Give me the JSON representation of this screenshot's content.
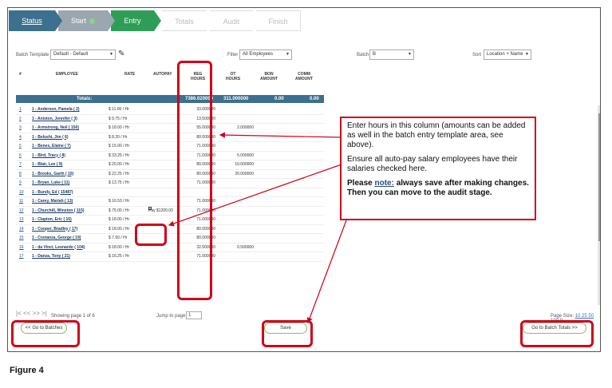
{
  "steps": [
    {
      "label": "Status"
    },
    {
      "label": "Start"
    },
    {
      "label": "Entry"
    },
    {
      "label": "Totals"
    },
    {
      "label": "Audit"
    },
    {
      "label": "Finish"
    }
  ],
  "filters": {
    "batch_template_label": "Batch Template",
    "batch_template_value": "Default - Default",
    "filter_label": "Filter",
    "filter_value": "All Employees",
    "batch_label": "Batch",
    "batch_value": "B",
    "sort_label": "Sort",
    "sort_value": "Location + Name"
  },
  "table": {
    "headers": {
      "num": "#",
      "employee": "EMPLOYEE",
      "rate": "RATE",
      "autopay": "AUTOPAY",
      "reg": "REG HOURS",
      "ot": "OT HOURS",
      "bon": "BON AMOUNT",
      "comm": "COMM AMOUNT"
    },
    "totals": {
      "label": "Totals:",
      "reg": "7386.020000",
      "ot": "311.000000",
      "bon": "0.00",
      "comm": "0.00"
    },
    "rows": [
      {
        "num": "1",
        "employee": "1 - Anderson, Pamela ( 2)",
        "rate": "$ 11.00 / Hr",
        "reg": "33.000000",
        "ot": ""
      },
      {
        "num": "2",
        "employee": "1 - Aniston, Jennifer ( 3)",
        "rate": "$ 9.75 / Hr",
        "reg": "13.500000",
        "ot": ""
      },
      {
        "num": "3",
        "employee": "1 - Armstrong, Neil ( 150)",
        "rate": "$ 18.00 / Hr",
        "reg": "55.000000",
        "ot": "2.000000"
      },
      {
        "num": "4",
        "employee": "1 - Belushi, Jim ( 6)",
        "rate": "$ 8.20 / Hr",
        "reg": "80.000000",
        "ot": ""
      },
      {
        "num": "5",
        "employee": "1 - Benes, Elaine ( 7)",
        "rate": "$ 15.00 / Hr",
        "reg": "71.000000",
        "ot": ""
      },
      {
        "num": "6",
        "employee": "1 - Bird, Tracy ( 8)",
        "rate": "$ 33.25 / Hr",
        "reg": "71.000000",
        "ot": "5.000000"
      },
      {
        "num": "7",
        "employee": "1 - Blair, Lee ( 9)",
        "rate": "$ 20.00 / Hr",
        "reg": "80.000000",
        "ot": "10.000000"
      },
      {
        "num": "8",
        "employee": "1 - Brooks, Garth ( 10)",
        "rate": "$ 22.25 / Hr",
        "reg": "80.000000",
        "ot": "20.000000"
      },
      {
        "num": "9",
        "employee": "1 - Bryan, Luke ( 11)",
        "rate": "$ 13.75 / Hr",
        "reg": "71.000000",
        "ot": ""
      },
      {
        "num": "10",
        "employee": "1 - Bundy, Ed ( 15487)",
        "rate": "",
        "reg": "",
        "ot": ""
      },
      {
        "num": "11",
        "employee": "1 - Carey, Mariah ( 13)",
        "rate": "$ 16.53 / Hr",
        "reg": "71.000000",
        "ot": ""
      },
      {
        "num": "12",
        "employee": "1 - Churchill, Winston ( 115)",
        "rate": "$ 75.00 / Hr",
        "reg": "71.000000",
        "ot": "",
        "autopay": "Pay $1200.00"
      },
      {
        "num": "13",
        "employee": "1 - Clapton, Eric ( 16)",
        "rate": "$ 18.00 / Hr",
        "reg": "71.000000",
        "ot": ""
      },
      {
        "num": "14",
        "employee": "1 - Cooper, Bradley ( 17)",
        "rate": "$ 18.00 / Hr",
        "reg": "80.000000",
        "ot": ""
      },
      {
        "num": "15",
        "employee": "1 - Costanza, George ( 19)",
        "rate": "$ 7.50 / Hr",
        "reg": "80.000000",
        "ot": ""
      },
      {
        "num": "16",
        "employee": "1 - da Vinci, Leonardo ( 104)",
        "rate": "$ 18.00 / Hr",
        "reg": "32.500000",
        "ot": "0.500000"
      },
      {
        "num": "17",
        "employee": "1 - Danza, Tony ( 21)",
        "rate": "$ 16.25 / Hr",
        "reg": "71.000000",
        "ot": ""
      }
    ]
  },
  "pager": {
    "nav": "|< << >> >|",
    "showing": "Showing page 1 of 6",
    "jump_label": "Jump to page:",
    "jump_value": "1",
    "page_size_label": "Page Size:",
    "page_size_links": "10 25 50 100 9"
  },
  "buttons": {
    "batches": "<< Go to Batches",
    "save": "Save",
    "totals": "Go to Batch Totals >>"
  },
  "callout": {
    "p1": "Enter hours in this column (amounts can be added as well in the batch entry template area, see above).",
    "p2": "Ensure all auto-pay salary employees have their salaries checked here.",
    "p3_a": "Please ",
    "p3_note": "note:",
    "p3_b": " always save after making changes. Then you can move to the audit stage."
  },
  "figure_caption": "Figure 4",
  "colors": {
    "status_step": "#3d6f8e",
    "entry_step": "#2e9e57",
    "annotation_red": "#d0021b",
    "totals_bar": "#3d6f8e"
  }
}
